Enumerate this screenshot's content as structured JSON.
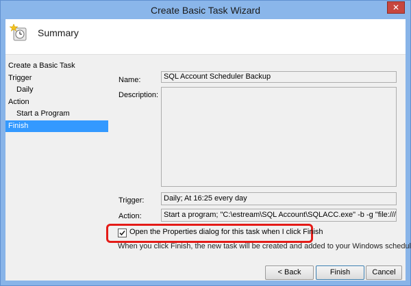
{
  "window": {
    "title": "Create Basic Task Wizard",
    "close_glyph": "✕"
  },
  "header": {
    "title": "Summary",
    "icon": "task-scheduler-icon"
  },
  "nav": {
    "items": [
      {
        "label": "Create a Basic Task",
        "indent": false,
        "active": false
      },
      {
        "label": "Trigger",
        "indent": false,
        "active": false
      },
      {
        "label": "Daily",
        "indent": true,
        "active": false
      },
      {
        "label": "Action",
        "indent": false,
        "active": false
      },
      {
        "label": "Start a Program",
        "indent": true,
        "active": false
      },
      {
        "label": "Finish",
        "indent": false,
        "active": true
      }
    ]
  },
  "summary": {
    "name_label": "Name:",
    "name_value": "SQL Account Scheduler Backup",
    "description_label": "Description:",
    "description_value": "",
    "trigger_label": "Trigger:",
    "trigger_value": "Daily; At 16:25 every day",
    "action_label": "Action:",
    "action_value": "Start a program; \"C:\\estream\\SQL Account\\SQLACC.exe\"  -b -g \"file:///C:/Te"
  },
  "options": {
    "open_properties_label": "Open the Properties dialog for this task when I click Finish",
    "open_properties_checked": true,
    "info_text": "When you click Finish, the new task will be created and added to your Windows schedule."
  },
  "buttons": {
    "back": "< Back",
    "finish": "Finish",
    "cancel": "Cancel"
  },
  "colors": {
    "highlight": "#e41b17",
    "nav_active": "#3399ff",
    "titlebar": "#8ab6ea"
  }
}
